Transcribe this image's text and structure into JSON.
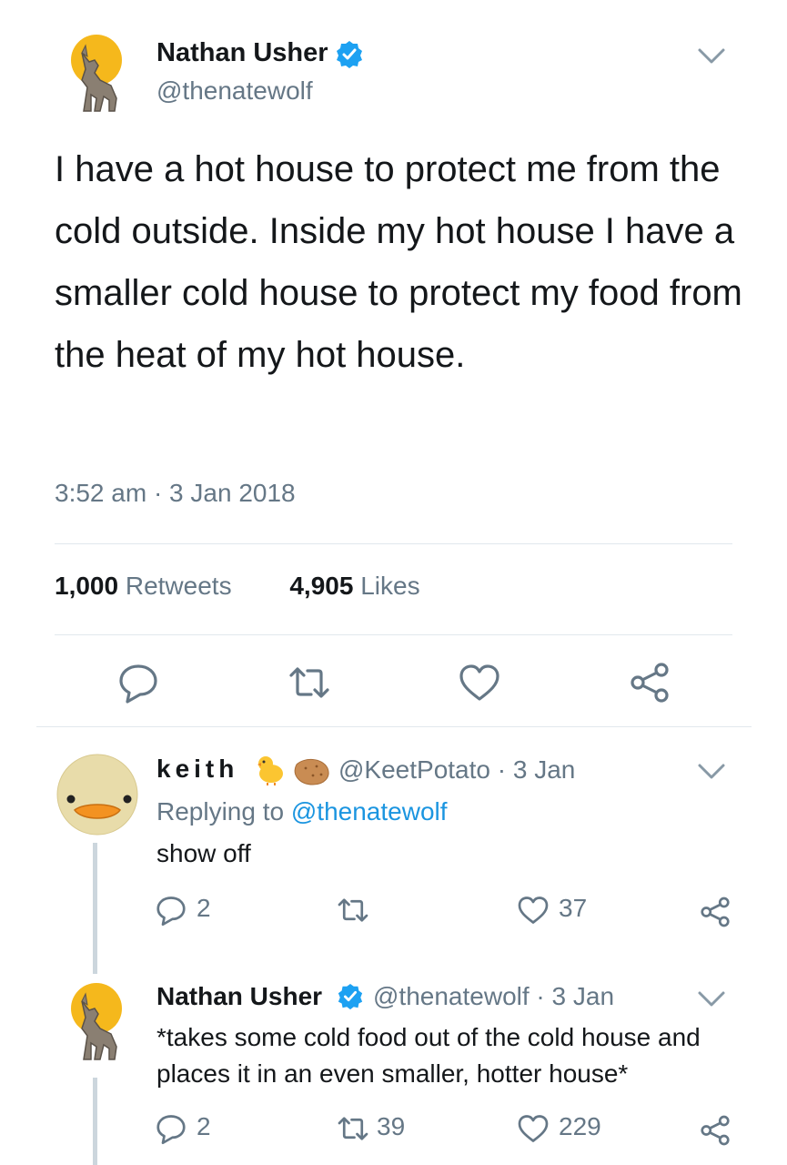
{
  "main_tweet": {
    "avatar": "howling-wolf-moon-avatar",
    "name": "Nathan Usher",
    "handle": "@thenatewolf",
    "text": "I have a hot house to protect me from the cold outside. Inside my hot house I have a smaller cold house to protect my food from the heat of my hot house.",
    "timestamp": "3:52 am · 3 Jan 2018",
    "retweets_count": "1,000",
    "retweets_label": "Retweets",
    "likes_count": "4,905",
    "likes_label": "Likes",
    "actions": [
      "reply-icon",
      "retweet-icon",
      "like-icon",
      "share-icon"
    ]
  },
  "replies": [
    {
      "avatar": "duck-face-avatar",
      "name": "keith",
      "emojis": [
        "chick-emoji",
        "potato-emoji"
      ],
      "handle": "@KeetPotato",
      "date": "3 Jan",
      "meta": "@KeetPotato · 3 Jan",
      "replying_prefix": "Replying to",
      "replying_to": "@thenatewolf",
      "text": "show off",
      "reply_count": "2",
      "retweet_count": "",
      "like_count": "37"
    },
    {
      "avatar": "howling-wolf-moon-avatar",
      "name": "Nathan Usher",
      "handle": "@thenatewolf",
      "date": "3 Jan",
      "meta": "@thenatewolf · 3 Jan",
      "text": "*takes some cold food out of the cold house and places it in an even smaller, hotter house*",
      "reply_count": "2",
      "retweet_count": "39",
      "like_count": "229"
    }
  ],
  "colors": {
    "text": "#14171a",
    "secondary": "#657786",
    "link": "#1b95e0",
    "verified": "#1da1f2",
    "divider": "#e1e8ed",
    "moon": "#f5b81c"
  }
}
